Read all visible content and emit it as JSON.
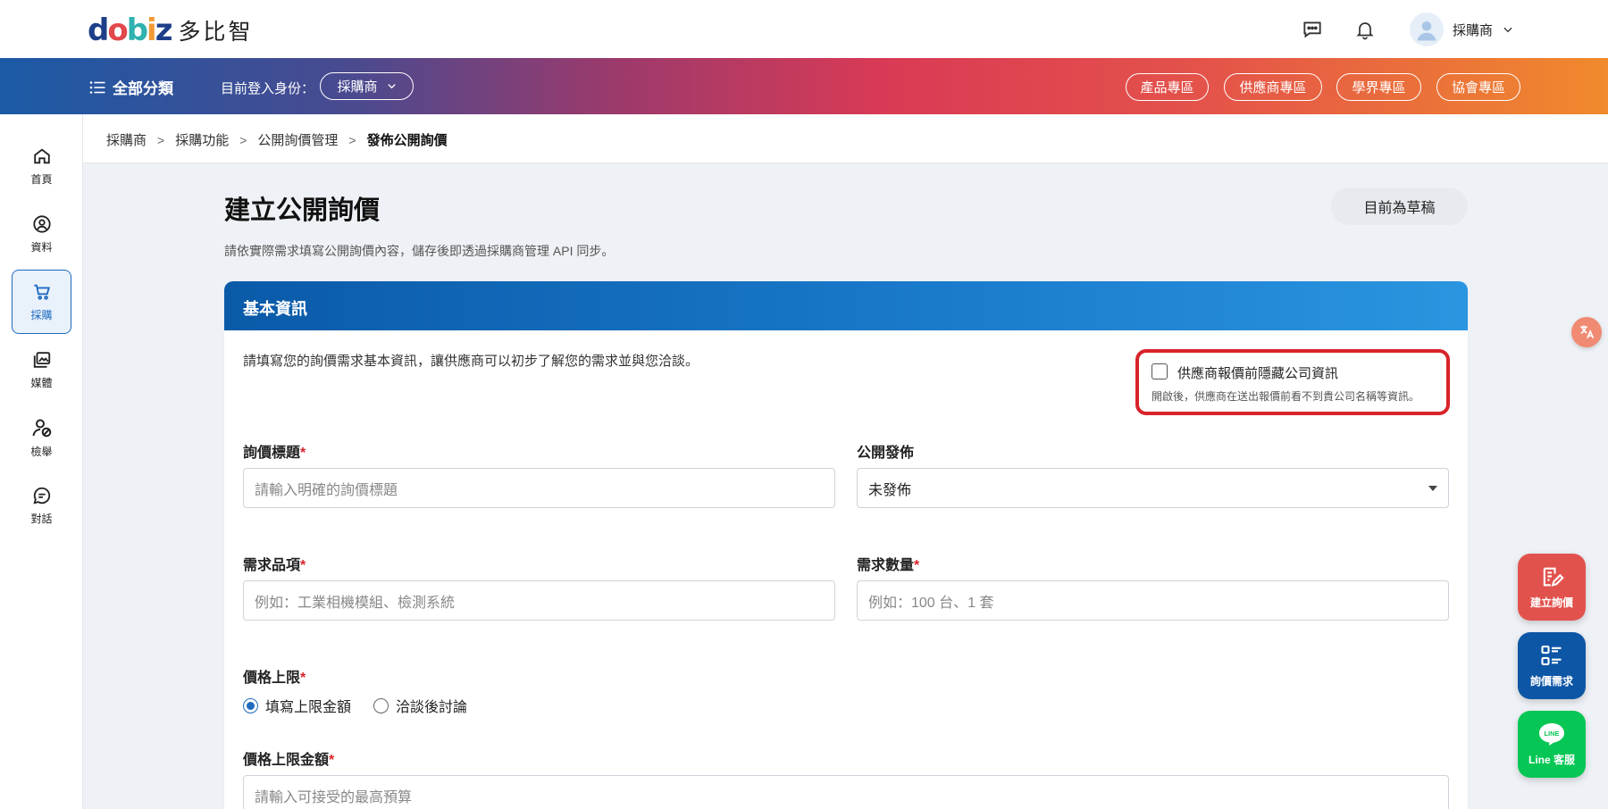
{
  "brand": {
    "logo_text": "多比智",
    "logo_mark": [
      "d",
      "o",
      "b",
      "i",
      "z"
    ]
  },
  "header": {
    "user_name": "採購商"
  },
  "nav": {
    "all_categories": "全部分類",
    "login_as_label": "目前登入身份：",
    "role": "採購商",
    "zones": [
      "產品專區",
      "供應商專區",
      "學界專區",
      "協會專區"
    ]
  },
  "sidebar": {
    "items": [
      {
        "label": "首頁",
        "icon": "home-icon"
      },
      {
        "label": "資料",
        "icon": "user-circle-icon"
      },
      {
        "label": "採購",
        "icon": "cart-icon",
        "active": true
      },
      {
        "label": "媒體",
        "icon": "media-icon"
      },
      {
        "label": "檢舉",
        "icon": "report-user-icon"
      },
      {
        "label": "對話",
        "icon": "chat-icon"
      }
    ]
  },
  "breadcrumb": [
    "採購商",
    "採購功能",
    "公開詢價管理",
    "發佈公開詢價"
  ],
  "page": {
    "title": "建立公開詢價",
    "status": "目前為草稿",
    "subtitle": "請依實際需求填寫公開詢價內容，儲存後即透過採購商管理 API 同步。"
  },
  "card": {
    "title": "基本資訊",
    "description": "請填寫您的詢價需求基本資訊，讓供應商可以初步了解您的需求並與您洽談。",
    "hide_company": {
      "label": "供應商報價前隱藏公司資訊",
      "note": "開啟後，供應商在送出報價前看不到貴公司名稱等資訊。",
      "checked": false
    },
    "fields": {
      "title": {
        "label": "詢價標題",
        "placeholder": "請輸入明確的詢價標題"
      },
      "publish": {
        "label": "公開發佈",
        "value": "未發佈"
      },
      "item": {
        "label": "需求品項",
        "placeholder": "例如：工業相機模組、檢測系統"
      },
      "quantity": {
        "label": "需求數量",
        "placeholder": "例如：100 台、1 套"
      },
      "price_limit": {
        "label": "價格上限",
        "options": [
          "填寫上限金額",
          "洽談後討論"
        ],
        "selected": 0
      },
      "price_amount": {
        "label": "價格上限金額",
        "placeholder": "請輸入可接受的最高預算"
      }
    },
    "required_mark": "*"
  },
  "fabs": [
    {
      "label": "建立詢價",
      "color": "#e2524d",
      "icon": "edit-note-icon"
    },
    {
      "label": "詢價需求",
      "color": "#0d56a6",
      "icon": "list-icon"
    },
    {
      "label": "Line 客服",
      "color": "#06c755",
      "icon": "line-icon",
      "badge": "LINE"
    }
  ],
  "translate_icon": "translate-icon"
}
